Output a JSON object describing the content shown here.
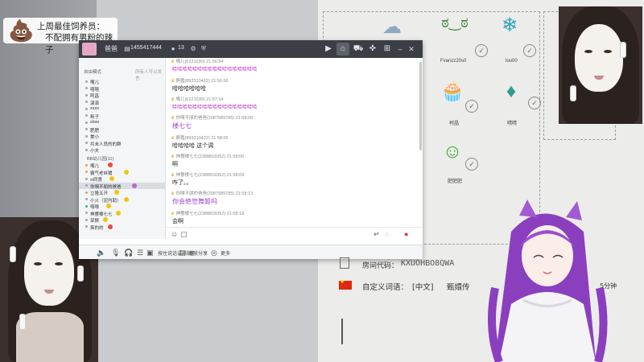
{
  "banner": {
    "icon": "poop-icon",
    "line1": "上周最佳饲养员：",
    "line2": "不配拥有男粉的辣子"
  },
  "chat_window": {
    "title_name": "爸爸",
    "id": "1455417444",
    "member_count": "13",
    "members": {
      "mode_label": "自由模式",
      "hint": "所有人可以发言",
      "online": [
        "嘴儿",
        "嘻嘻",
        "阿昌",
        "演演",
        "xxxx",
        "耗子",
        "slow",
        "肥肥",
        "棠小",
        "共未人员的的群",
        "小夫"
      ],
      "group_label": "BB幼儿园(11)",
      "group_members": [
        "嘴儿",
        "霸气老丝猪",
        "xi同意",
        "你嘿不朋的爸爸",
        "立隆五开",
        "小火（泥内助）",
        "嘻嘻",
        "神蔷楼七七",
        "旱猴",
        "爽的的"
      ]
    },
    "messages": [
      {
        "meta": "嘴儿(6221030) 21:56:54",
        "text": "哈哈哈哈哈哈哈哈哈哈哈哈哈哈哈哈哈",
        "style": "pink"
      },
      {
        "meta": "婀嘉(893310422) 21:56:56",
        "text": "哈哈哈哈哈哈",
        "style": "normal"
      },
      {
        "meta": "嘴儿(6221030) 21:57:24",
        "text": "哈哈哈哈哈哈哈哈哈哈哈哈哈哈哈哈哈",
        "style": "pink"
      },
      {
        "meta": "你嘿不朋的爸爸(2087989785) 21:58:00",
        "text": "楼七七",
        "style": "purple"
      },
      {
        "meta": "婀嘉(893310422) 21:58:05",
        "text": "哈哈哈哈  这个调",
        "style": "normal"
      },
      {
        "meta": "神蔷楼七七(2388818352) 21:58:06",
        "text": "啊",
        "style": "normal"
      },
      {
        "meta": "神蔷楼七七(2388818352) 21:58:09",
        "text": "咋了。。",
        "style": "normal"
      },
      {
        "meta": "你嘿不朋的爸爸(2087989785) 21:58:13",
        "text": "你会绝世舞姬吗",
        "style": "purple"
      },
      {
        "meta": "神蔷楼七七(2388818352) 21:58:18",
        "text": "会啊",
        "style": "normal"
      }
    ],
    "bottom_bar": {
      "mic_label": "按住说话讲2倍速",
      "share_label": "播放分享",
      "more_label": "更多"
    }
  },
  "stickers": [
    {
      "icon": "cat-cloud-icon",
      "label": ""
    },
    {
      "icon": "face-icon",
      "label": "Fvanzz20s0"
    },
    {
      "icon": "snowcloud-icon",
      "label": "lou00"
    },
    {
      "icon": "cupcake-icon",
      "label": "柯晶"
    },
    {
      "icon": "crystal-icon",
      "label": "晴晴"
    },
    {
      "icon": "grin-icon",
      "label": "肥肥肥"
    }
  ],
  "info": {
    "room_code_label": "房间代码：",
    "room_code": "KXUOHBO8QWA",
    "custom_word_label": "自定义词语：",
    "custom_word_tag": "[中文]",
    "custom_word_value": "甄嬛传",
    "minutes": "5分钟"
  },
  "colors": {
    "titlebar": "#3b3f45",
    "pink_text": "#c22bc6",
    "purple_text": "#9c47c9",
    "flag": "#de2910"
  }
}
